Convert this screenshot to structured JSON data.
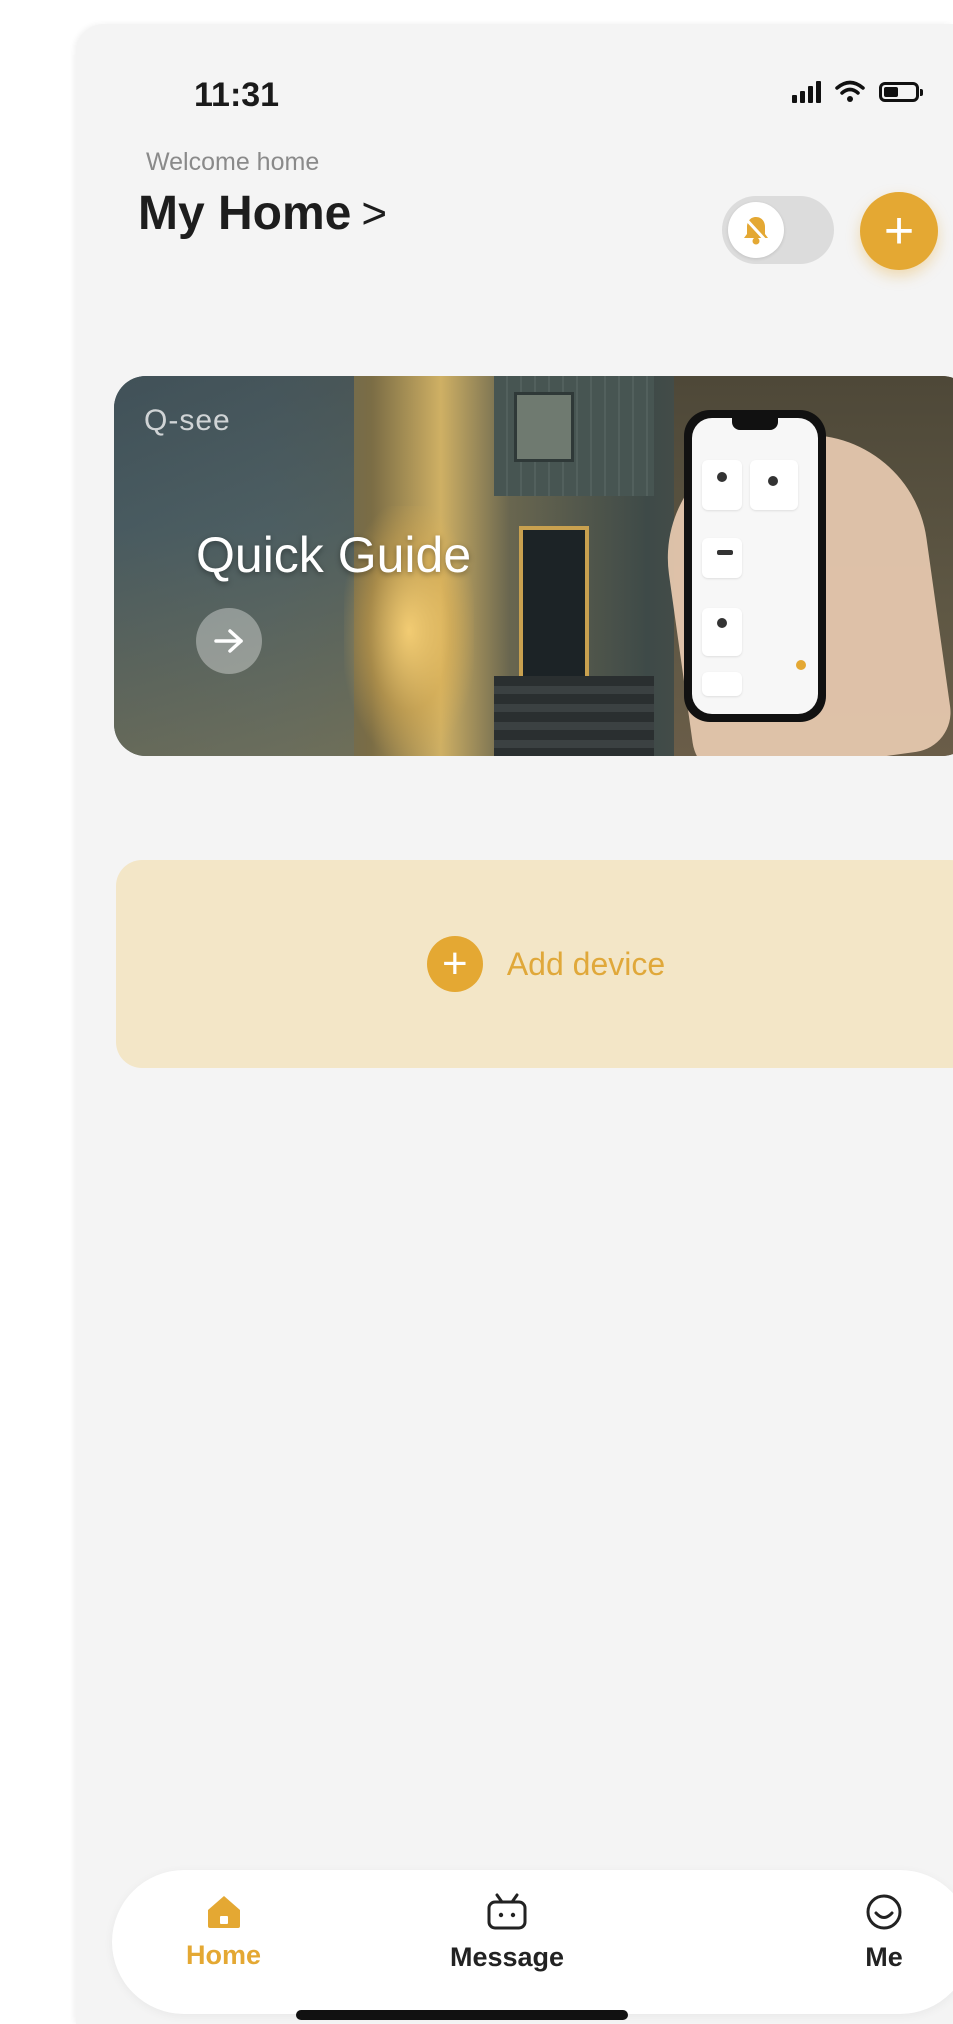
{
  "status_bar": {
    "time": "11:31"
  },
  "header": {
    "welcome": "Welcome home",
    "home_name": "My Home",
    "chevron": ">"
  },
  "banner": {
    "logo": "Q-see",
    "title": "Quick Guide"
  },
  "add_card": {
    "label": "Add device"
  },
  "tabbar": {
    "items": [
      {
        "label": "Home",
        "icon": "home-icon",
        "active": true
      },
      {
        "label": "Message",
        "icon": "message-icon",
        "active": false
      },
      {
        "label": "Me",
        "icon": "smiley-icon",
        "active": false
      }
    ]
  },
  "colors": {
    "accent": "#e4a833",
    "card_bg": "#f3e6c7",
    "background": "#f4f4f4"
  }
}
